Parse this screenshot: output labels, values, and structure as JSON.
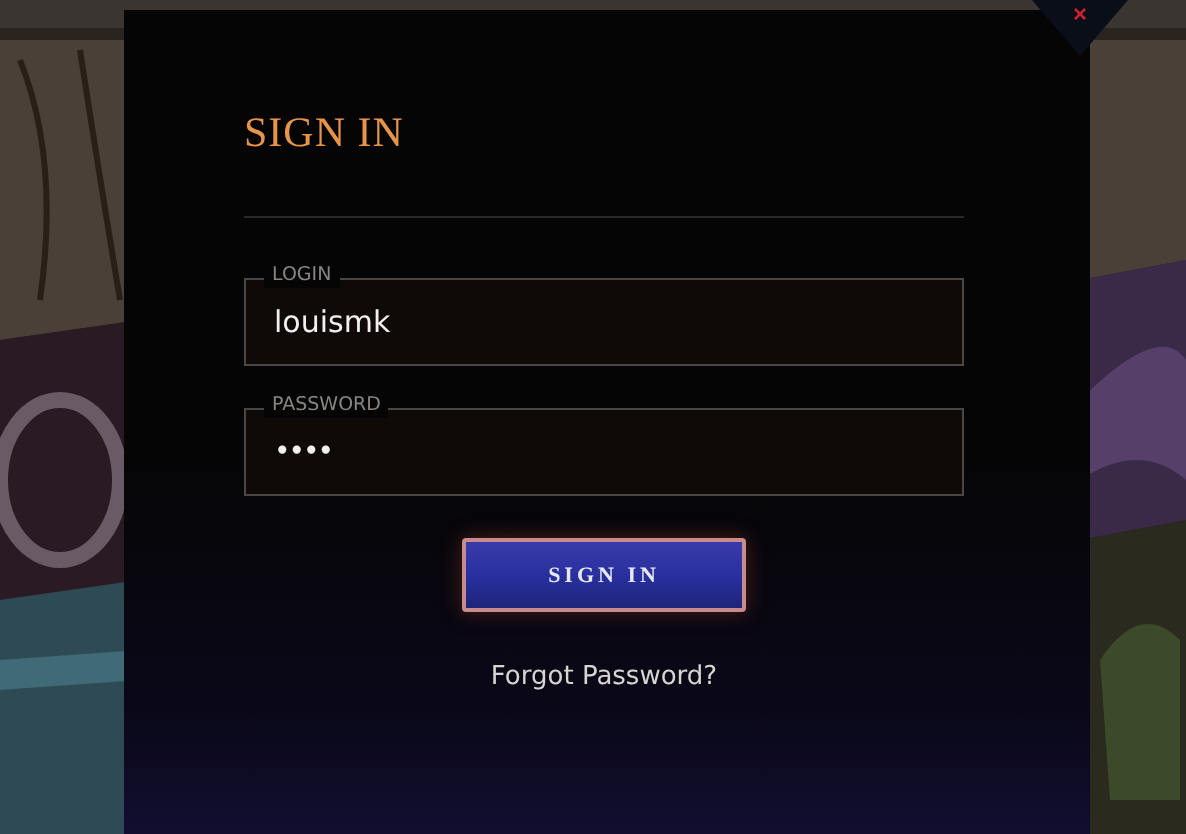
{
  "dialog": {
    "title": "SIGN IN",
    "close": "×",
    "fields": [
      {
        "label": "LOGIN",
        "value": "louismk",
        "kind": "text"
      },
      {
        "label": "PASSWORD",
        "value": "••••",
        "kind": "password"
      }
    ],
    "submit": "SIGN IN",
    "forgot_link": "Forgot Password?"
  }
}
